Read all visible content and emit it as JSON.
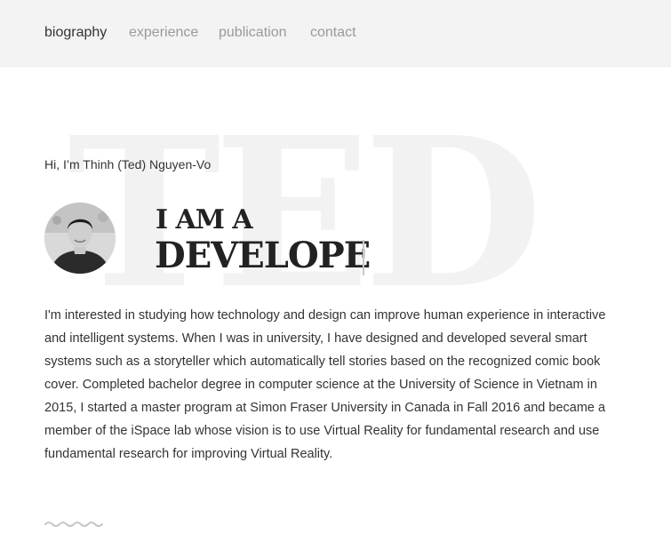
{
  "nav": {
    "items": [
      {
        "label": "biography",
        "active": true
      },
      {
        "label": "experience",
        "active": false
      },
      {
        "label": "publication",
        "active": false
      },
      {
        "label": "contact",
        "active": false
      }
    ]
  },
  "hero": {
    "watermark": "TED",
    "greeting": "Hi, I’m Thinh (Ted) Nguyen-Vo",
    "headline_top": "I AM A",
    "headline_main": "DEVELOPE",
    "avatar_icon": "profile-photo"
  },
  "bio": {
    "text": "I'm interested in studying how technology and design can improve human experience in interactive and intelligent systems. When I was in university, I have designed and developed several smart systems such as a storyteller which automatically tell stories based on the recognized comic book cover. Completed bachelor degree in computer science at the University of Science in Vietnam in 2015, I started a master program at Simon Fraser University in Canada in Fall 2016 and became a member of the iSpace lab whose vision is to use Virtual Reality for fundamental research and use fundamental research for improving Virtual Reality."
  },
  "colors": {
    "nav_background": "#f3f3f3",
    "nav_active": "#333333",
    "nav_inactive": "#9a9a9a",
    "watermark": "#f2f2f2",
    "headline": "#222222"
  }
}
